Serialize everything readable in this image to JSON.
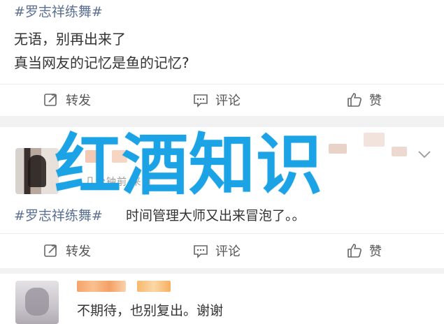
{
  "post1": {
    "hashtag": "#罗志祥练舞#",
    "line1": "无语，别再出来了",
    "line2": "真当网友的记忆是鱼的记忆?"
  },
  "actions": {
    "repost": "转发",
    "comment": "评论",
    "like": "赞"
  },
  "overlay": {
    "title": "红酒知识"
  },
  "comment1": {
    "meta": "几分钟前  来自"
  },
  "post2": {
    "hashtag": "#罗志祥练舞#",
    "text": "时间管理大师又出来冒泡了。。"
  },
  "comment2": {
    "text": "不期待，也别复出。谢谢"
  },
  "colors": {
    "hashtag": "#5a6f92",
    "overlay": "#1ca3e6",
    "action_text": "#555555",
    "separator": "#f2f2f2"
  }
}
